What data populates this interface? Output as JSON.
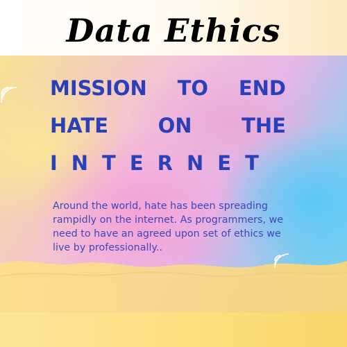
{
  "header": {
    "title": "Data Ethics"
  },
  "poster": {
    "headline_line1": [
      "MISSION",
      "TO",
      "END"
    ],
    "headline_line2": [
      "HATE",
      "ON",
      "THE"
    ],
    "headline_line3": "INTERNET",
    "body": "Around the world, hate has been spreading rampidly on the internet. As programmers, we need to have an agreed upon set of ethics we live by professionally.."
  },
  "colors": {
    "title": "#000000",
    "headline": "#2a3fb8",
    "body_text": "#3f46b8",
    "bottom_band": "#fde081"
  }
}
